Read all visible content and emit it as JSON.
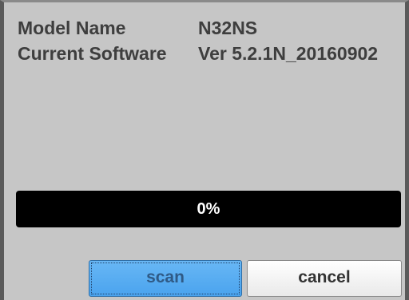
{
  "dialog": {
    "model_label": "Model Name",
    "model_value": "N32NS",
    "software_label": "Current Software",
    "software_value": "Ver  5.2.1N_20160902"
  },
  "progress": {
    "percent": 0,
    "text": "0%"
  },
  "buttons": {
    "scan_label": "scan",
    "cancel_label": "cancel"
  },
  "colors": {
    "background": "#c6c6c6",
    "progress_track": "#000000",
    "scan_button": "#4aa3ee",
    "cancel_button": "#ffffff"
  }
}
